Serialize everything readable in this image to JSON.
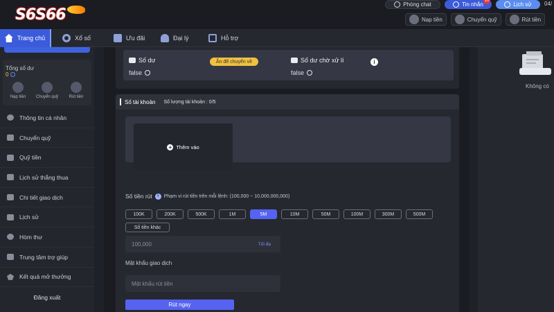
{
  "header": {
    "logo_text": "S6S66",
    "chat_label": "Phòng chat",
    "messages_label": "Tin nhắn",
    "messages_badge": "10",
    "history_label": "Lịch sử",
    "date_partial": "04/"
  },
  "quick_actions": [
    "Nạp tiền",
    "Chuyển quỹ",
    "Rút tiền"
  ],
  "nav": {
    "items": [
      {
        "label": "Trang chủ",
        "icon": "home-icon"
      },
      {
        "label": "Xổ số",
        "icon": "lottery-icon"
      },
      {
        "label": "Ưu đãi",
        "icon": "gift-icon"
      },
      {
        "label": "Đại lý",
        "icon": "agent-icon"
      },
      {
        "label": "Hỗ trợ",
        "icon": "support-icon"
      }
    ]
  },
  "sidebar": {
    "total_balance_label": "Tổng số dư",
    "total_balance_value": "0",
    "actions": [
      "Nạp tiền",
      "Chuyển quỹ",
      "Rút tiền"
    ],
    "menu": [
      "Thông tin cá nhân",
      "Chuyển quỹ",
      "Quỹ tiền",
      "Lịch sử thắng thua",
      "Chi tiết giao dịch",
      "Lịch sử",
      "Hòm thư",
      "Trung tâm trợ giúp",
      "Kết quả mở thưởng"
    ],
    "logout_label": "Đăng xuất"
  },
  "balance_card": {
    "balance_label": "Số dư",
    "balance_value": "false",
    "hide_transfer_label": "Ẩn để chuyển về",
    "pending_label": "Số dư chờ xử lí",
    "pending_value": "false"
  },
  "accounts": {
    "title": "Số tài khoản",
    "count_label": "Số lượng tài khoản : 0/5",
    "add_label": "Thêm vào"
  },
  "withdraw": {
    "amount_label": "Số tiền rút",
    "range_note": "Phạm vi rút tiền trên mỗi lệnh:  (100,000 ~ 10,000,000,000)",
    "chips_row1": [
      "100K",
      "200K",
      "500K",
      "1M",
      "5M",
      "10M",
      "50M",
      "100M",
      "300M",
      "500M"
    ],
    "selected_chip": "5M",
    "other_amount_label": "Số tiền khác",
    "amount_value": "100,000",
    "max_label": "Tối đa",
    "password_label": "Mật khẩu giao dịch",
    "password_placeholder": "Mật khẩu rút tiền",
    "submit_label": "Rút ngay"
  },
  "right_panel": {
    "empty_text": "Không có"
  },
  "colors": {
    "accent": "#5563f0",
    "nav_active": "#3b5bdb",
    "badge_yellow": "#f0c040",
    "background": "#1f2129"
  }
}
